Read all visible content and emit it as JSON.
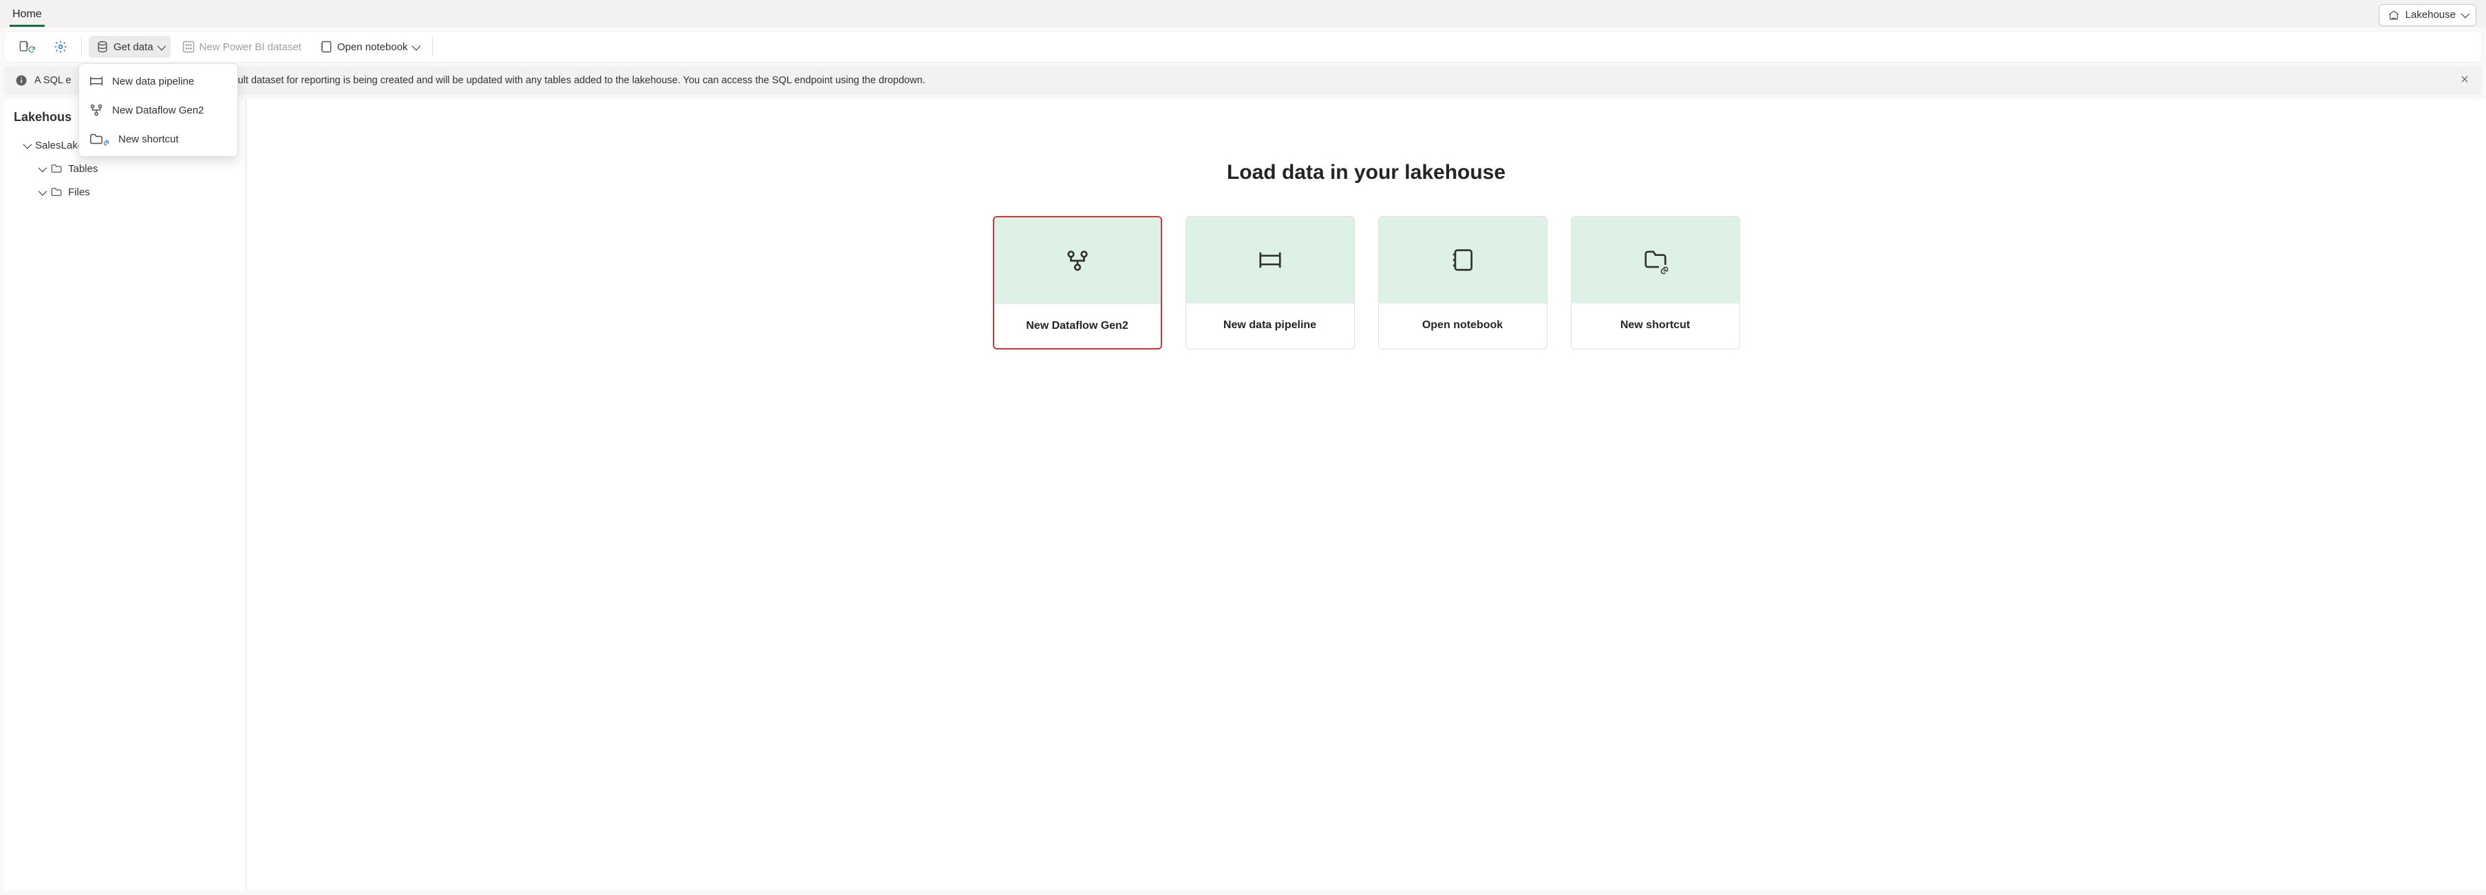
{
  "tabs": {
    "home": "Home"
  },
  "view_switch": {
    "label": "Lakehouse"
  },
  "toolbar": {
    "get_data": "Get data",
    "new_bi_dataset": "New Power BI dataset",
    "open_notebook": "Open notebook"
  },
  "get_data_menu": {
    "items": [
      {
        "label": "New data pipeline"
      },
      {
        "label": "New Dataflow Gen2"
      },
      {
        "label": "New shortcut"
      }
    ]
  },
  "info_banner": {
    "prefix": "A SQL e",
    "text": "efault dataset for reporting is being created and will be updated with any tables added to the lakehouse. You can access the SQL endpoint using the dropdown."
  },
  "explorer": {
    "title": "Lakehous",
    "root": "SalesLakehouse",
    "children": [
      {
        "label": "Tables"
      },
      {
        "label": "Files"
      }
    ]
  },
  "main": {
    "title": "Load data in your lakehouse",
    "cards": [
      {
        "label": "New Dataflow Gen2",
        "highlight": true
      },
      {
        "label": "New data pipeline",
        "highlight": false
      },
      {
        "label": "Open notebook",
        "highlight": false
      },
      {
        "label": "New shortcut",
        "highlight": false
      }
    ]
  }
}
